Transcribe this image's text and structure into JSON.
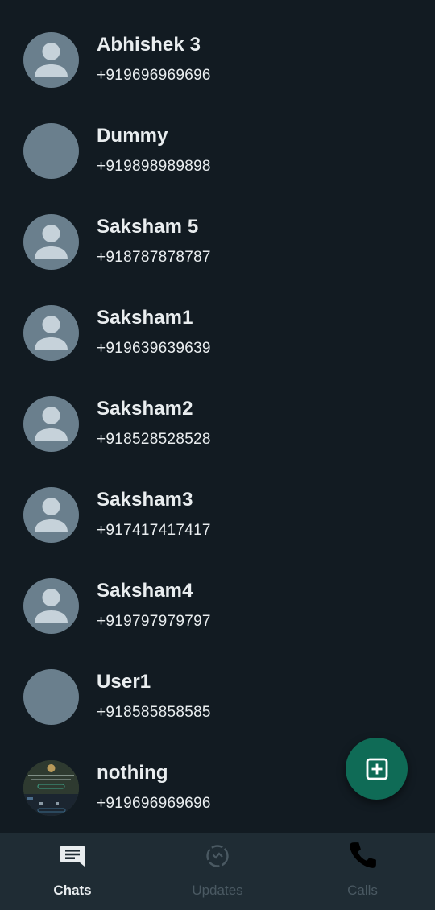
{
  "contacts": [
    {
      "name": "Abhishek 3",
      "phone": "+919696969696",
      "avatar": "person-icon"
    },
    {
      "name": "Dummy",
      "phone": "+919898989898",
      "avatar": "blank"
    },
    {
      "name": "Saksham 5",
      "phone": "+918787878787",
      "avatar": "person-icon"
    },
    {
      "name": "Saksham1",
      "phone": "+919639639639",
      "avatar": "person-icon"
    },
    {
      "name": "Saksham2",
      "phone": "+918528528528",
      "avatar": "person-icon"
    },
    {
      "name": "Saksham3",
      "phone": "+917417417417",
      "avatar": "person-icon"
    },
    {
      "name": "Saksham4",
      "phone": "+919797979797",
      "avatar": "person-icon"
    },
    {
      "name": "User1",
      "phone": "+918585858585",
      "avatar": "blank"
    },
    {
      "name": "nothing",
      "phone": "+919696969696",
      "avatar": "photo"
    }
  ],
  "fab": {
    "icon": "add-box-icon"
  },
  "nav": {
    "chats": {
      "label": "Chats",
      "icon": "chat-icon"
    },
    "updates": {
      "label": "Updates",
      "icon": "status-icon"
    },
    "calls": {
      "label": "Calls",
      "icon": "phone-icon"
    }
  },
  "colors": {
    "background": "#121b22",
    "avatar": "#6a7f8d",
    "fab": "#0f6b56",
    "nav_background": "#1f2c34",
    "nav_inactive": "#4a5962"
  }
}
